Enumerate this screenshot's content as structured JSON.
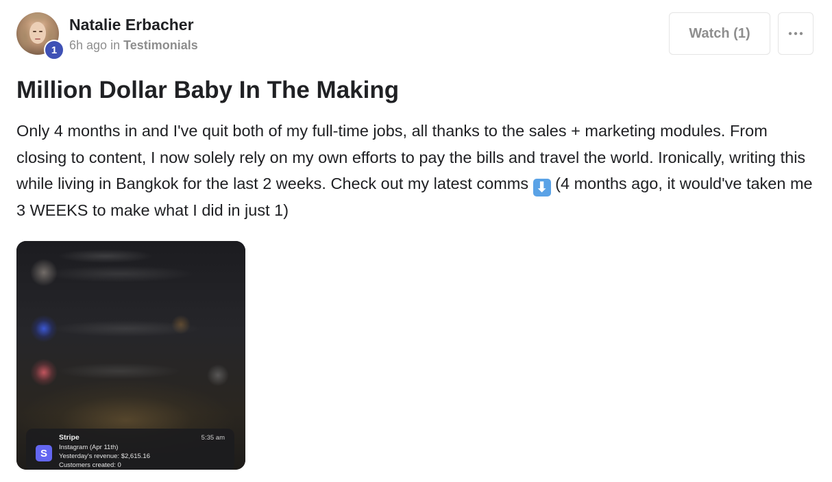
{
  "author": {
    "name": "Natalie Erbacher",
    "level": "1"
  },
  "post_info": {
    "time": "6h ago",
    "in_text": "in",
    "category": "Testimonials"
  },
  "actions": {
    "watch_label": "Watch (1)",
    "more_icon": "more-horizontal-icon"
  },
  "post": {
    "title": "Million Dollar Baby In The Making",
    "body_before_emoji": "Only 4 months in and I've quit both of my full-time jobs, all thanks to the sales + marketing modules. From closing to content, I now solely rely on my own efforts to pay the bills and travel the world. Ironically, writing this while living in Bangkok for the last 2 weeks. Check out my latest comms",
    "emoji": "⬇",
    "body_after_emoji": "(4 months ago, it would've taken me 3 WEEKS to make what I did in just 1)"
  },
  "attachment": {
    "notification": {
      "icon_letter": "S",
      "app": "Stripe",
      "time": "5:35 am",
      "line1": "Instagram (Apr 11th)",
      "line2": "Yesterday's revenue: $2,615.16",
      "line3": "Customers created: 0"
    }
  },
  "colors": {
    "badge": "#3f51b5",
    "muted_text": "#8e8e8e",
    "stripe_icon": "#6366f1",
    "emoji_bg": "#5aa2e6"
  }
}
